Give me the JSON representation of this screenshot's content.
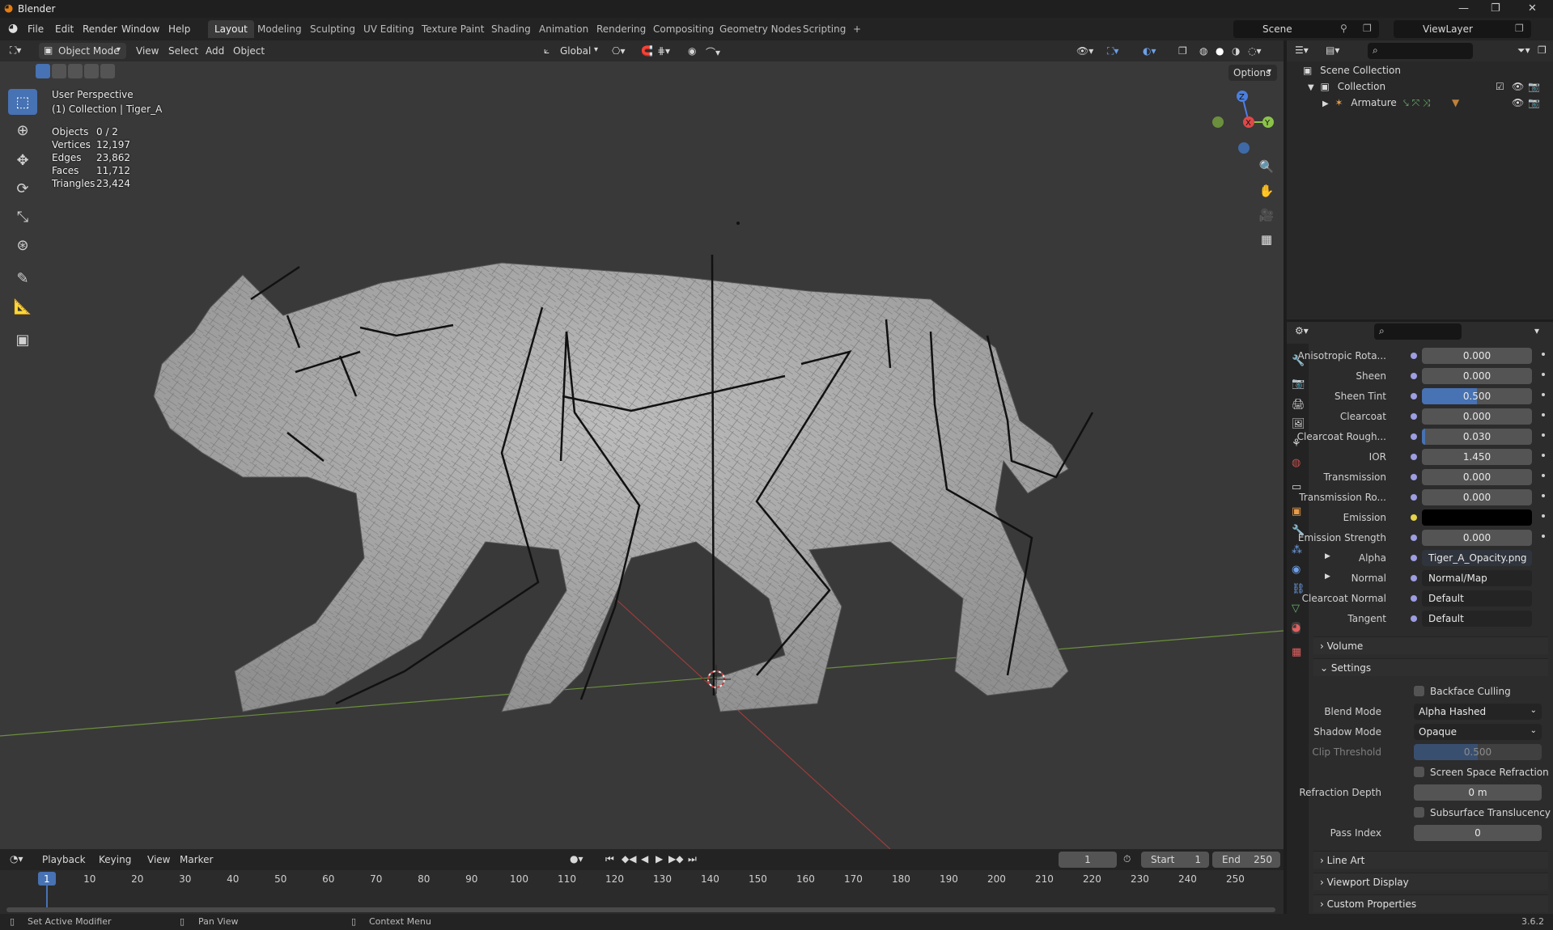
{
  "app": {
    "title": "Blender",
    "version": "3.6.2"
  },
  "menu": [
    "File",
    "Edit",
    "Render",
    "Window",
    "Help"
  ],
  "workspaces": [
    "Layout",
    "Modeling",
    "Sculpting",
    "UV Editing",
    "Texture Paint",
    "Shading",
    "Animation",
    "Rendering",
    "Compositing",
    "Geometry Nodes",
    "Scripting"
  ],
  "active_workspace": "Layout",
  "scene": {
    "name": "Scene",
    "view_layer": "ViewLayer"
  },
  "viewport_header": {
    "mode": "Object Mode",
    "menus": [
      "View",
      "Select",
      "Add",
      "Object"
    ],
    "orientation": "Global",
    "options": "Options"
  },
  "viewport_overlay": {
    "perspective": "User Perspective",
    "collection_line": "(1) Collection | Tiger_A",
    "stats": [
      {
        "key": "Objects",
        "value": "0 / 2"
      },
      {
        "key": "Vertices",
        "value": "12,197"
      },
      {
        "key": "Edges",
        "value": "23,862"
      },
      {
        "key": "Faces",
        "value": "11,712"
      },
      {
        "key": "Triangles",
        "value": "23,424"
      }
    ]
  },
  "gizmo": {
    "z": "Z",
    "x": "X",
    "y": "Y"
  },
  "outliner": {
    "root": "Scene Collection",
    "collection": "Collection",
    "item": "Armature"
  },
  "properties": {
    "rows": [
      {
        "label": "Anisotropic Rota...",
        "value": "0.000",
        "highlight": false
      },
      {
        "label": "Sheen",
        "value": "0.000",
        "highlight": false
      },
      {
        "label": "Sheen Tint",
        "value": "0.500",
        "highlight": true
      },
      {
        "label": "Clearcoat",
        "value": "0.000",
        "highlight": false
      },
      {
        "label": "Clearcoat Rough...",
        "value": "0.030",
        "highlight": false
      },
      {
        "label": "IOR",
        "value": "1.450",
        "highlight": false
      },
      {
        "label": "Transmission",
        "value": "0.000",
        "highlight": false
      },
      {
        "label": "Transmission Ro...",
        "value": "0.000",
        "highlight": false
      },
      {
        "label": "Emission",
        "value": "",
        "highlight": false
      },
      {
        "label": "Emission Strength",
        "value": "0.000",
        "highlight": false
      }
    ],
    "links": [
      {
        "label": "Alpha",
        "value": "Tiger_A_Opacity.png"
      },
      {
        "label": "Normal",
        "value": "Normal/Map"
      },
      {
        "label": "Clearcoat Normal",
        "value": "Default"
      },
      {
        "label": "Tangent",
        "value": "Default"
      }
    ],
    "sections": {
      "volume": "Volume",
      "settings": "Settings",
      "line_art": "Line Art",
      "viewport_display": "Viewport Display",
      "custom_properties": "Custom Properties"
    },
    "settings": {
      "backface_culling": "Backface Culling",
      "blend_mode_label": "Blend Mode",
      "blend_mode": "Alpha Hashed",
      "shadow_mode_label": "Shadow Mode",
      "shadow_mode": "Opaque",
      "clip_threshold_label": "Clip Threshold",
      "clip_threshold": "0.500",
      "ssr": "Screen Space Refraction",
      "refraction_depth_label": "Refraction Depth",
      "refraction_depth": "0 m",
      "subsurface": "Subsurface Translucency",
      "pass_index_label": "Pass Index",
      "pass_index": "0"
    }
  },
  "timeline": {
    "menus": [
      "Playback",
      "Keying",
      "View",
      "Marker"
    ],
    "current_frame": "1",
    "start_label": "Start",
    "start": "1",
    "end_label": "End",
    "end": "250",
    "ticks": [
      "1",
      "10",
      "20",
      "30",
      "40",
      "50",
      "60",
      "70",
      "80",
      "90",
      "100",
      "110",
      "120",
      "130",
      "140",
      "150",
      "160",
      "170",
      "180",
      "190",
      "200",
      "210",
      "220",
      "230",
      "240",
      "250"
    ]
  },
  "statusbar": {
    "left": "Set Active Modifier",
    "middle": "Pan View",
    "right": "Context Menu"
  }
}
